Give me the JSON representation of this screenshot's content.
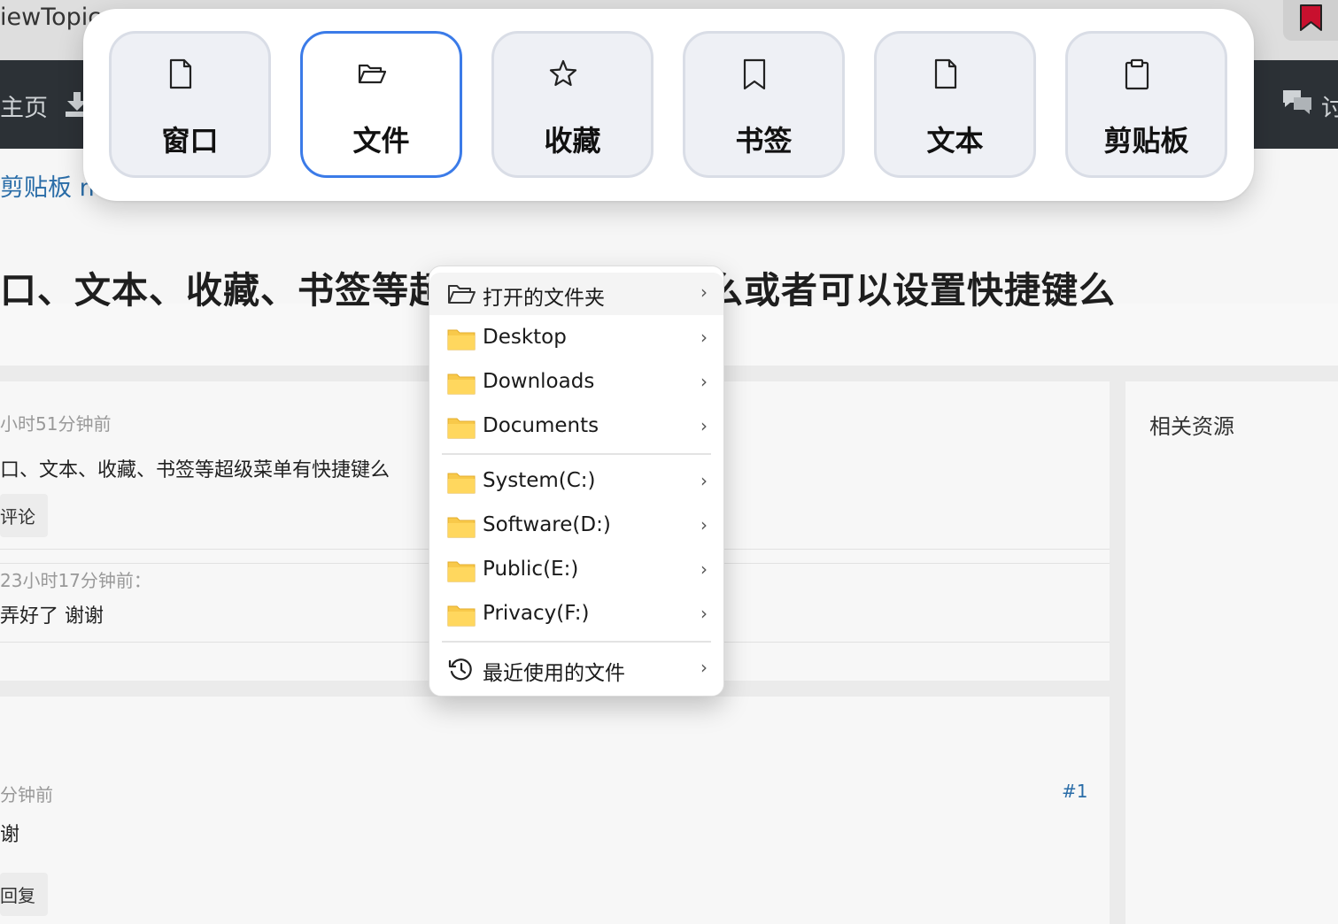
{
  "browser": {
    "tab_title": "iewTopic"
  },
  "site_nav": {
    "home_label": "主页",
    "discuss_label": "讨"
  },
  "breadcrumb": {
    "text": "剪贴板 n"
  },
  "topic": {
    "title": "口、文本、收藏、书签等超级菜单有快捷键么或者可以设置快捷键么",
    "meta_time": "小时51分钟前",
    "question": "口、文本、收藏、书签等超级菜单有快捷键么",
    "comment_button": "评论",
    "comment_meta": "23小时17分钟前：",
    "comment_text": "弄好了 谢谢"
  },
  "reply": {
    "meta_time": "分钟前",
    "index": "#1",
    "text": "谢",
    "reply_button": "回复"
  },
  "sidebar": {
    "title": "相关资源"
  },
  "super_menu": {
    "active_tab": "文件",
    "accent_color": "#3b7be8",
    "tabs": [
      {
        "label": "窗口",
        "icon": "window-doc-icon"
      },
      {
        "label": "文件",
        "icon": "folder-open-icon"
      },
      {
        "label": "收藏",
        "icon": "star-icon"
      },
      {
        "label": "书签",
        "icon": "bookmark-icon"
      },
      {
        "label": "文本",
        "icon": "document-icon"
      },
      {
        "label": "剪贴板",
        "icon": "clipboard-icon"
      }
    ]
  },
  "file_menu": {
    "items": [
      {
        "label": "打开的文件夹",
        "icon": "folder-open-icon"
      },
      {
        "label": "Desktop",
        "icon": "folder-icon"
      },
      {
        "label": "Downloads",
        "icon": "folder-icon"
      },
      {
        "label": "Documents",
        "icon": "folder-icon"
      },
      {
        "label": "System(C:)",
        "icon": "folder-icon"
      },
      {
        "label": "Software(D:)",
        "icon": "folder-icon"
      },
      {
        "label": "Public(E:)",
        "icon": "folder-icon"
      },
      {
        "label": "Privacy(F:)",
        "icon": "folder-icon"
      },
      {
        "label": "最近使用的文件",
        "icon": "history-icon"
      }
    ],
    "chevron": "›",
    "folder_color": "#f8c94a"
  }
}
